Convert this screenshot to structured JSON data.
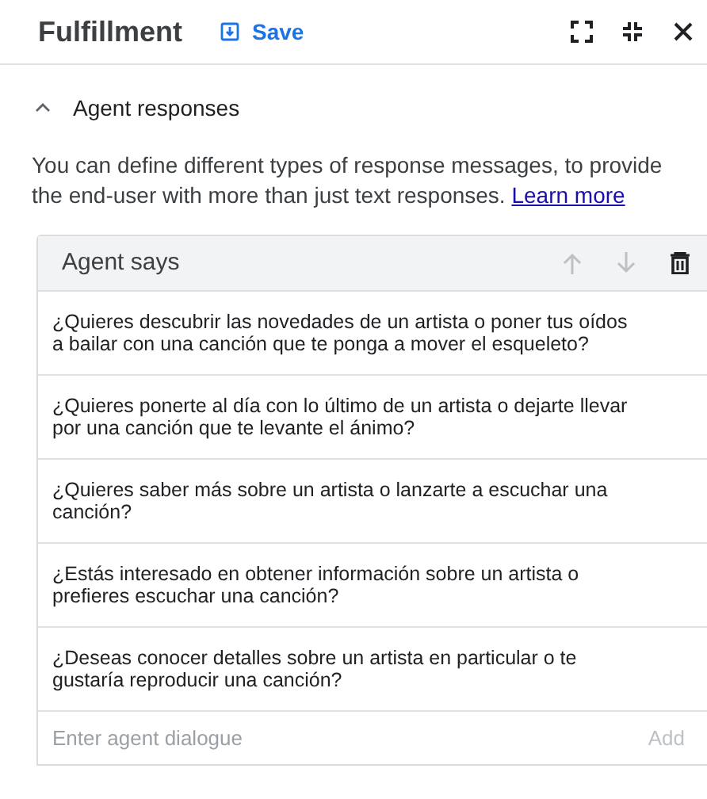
{
  "header": {
    "title": "Fulfillment",
    "save_label": "Save"
  },
  "section": {
    "title": "Agent responses",
    "expanded": true,
    "description": "You can define different types of response messages, to provide the end-user with more than just text responses.",
    "link": "Learn more"
  },
  "card": {
    "title": "Agent says",
    "actions": [
      {
        "kind": "up",
        "disabled": true
      },
      {
        "kind": "down",
        "disabled": true
      },
      {
        "kind": "delete",
        "disabled": false
      }
    ],
    "responses": [
      "¿Quieres descubrir las novedades de un artista o poner tus oídos a bailar con una canción que te ponga a mover el esqueleto?",
      "¿Quieres ponerte al día con lo último de un artista o dejarte llevar por una canción que te levante el ánimo?",
      "¿Quieres saber más sobre un artista o lanzarte a escuchar una canción?",
      "¿Estás interesado en obtener información sobre un artista o prefieres escuchar una canción?",
      "¿Deseas conocer detalles sobre un artista en particular o te gustaría reproducir una canción?"
    ],
    "input": {
      "placeholder": "Enter agent dialogue",
      "add_label": "Add"
    }
  }
}
